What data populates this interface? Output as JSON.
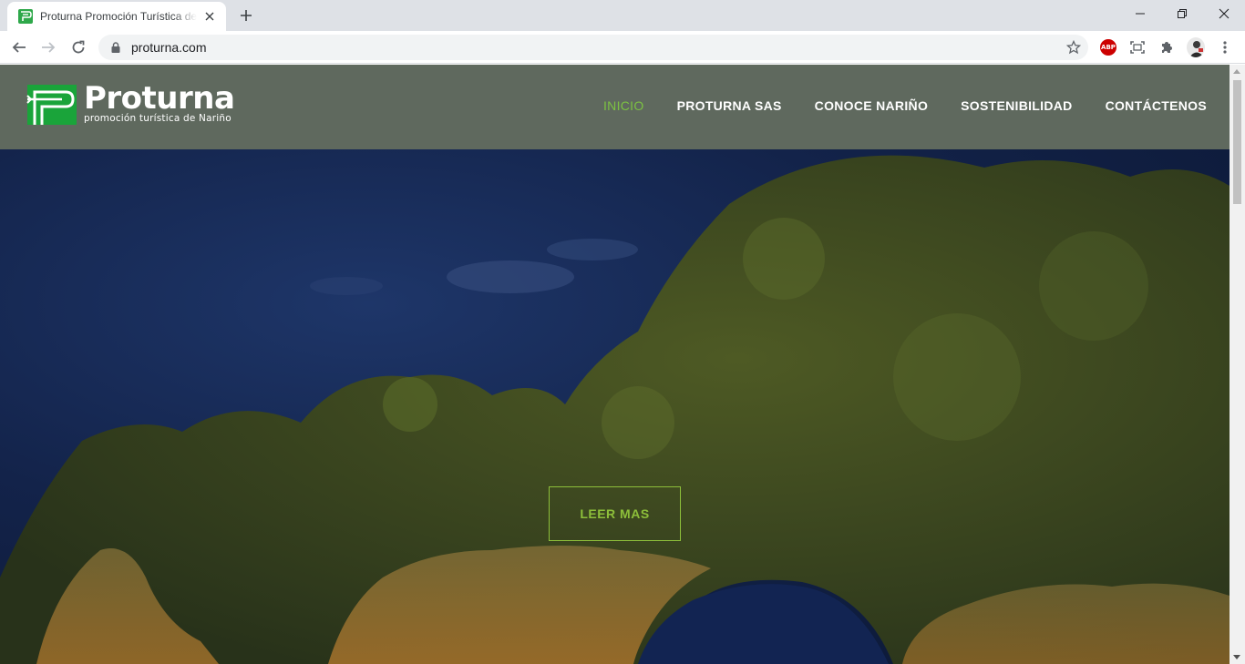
{
  "browser": {
    "tab_title": "Proturna Promoción Turística de Nariño",
    "url": "proturna.com",
    "extension_abp_label": "ABP",
    "accent_color": "#1a73e8"
  },
  "site": {
    "logo_name": "Proturna",
    "logo_tagline": "promoción turística de Nariño",
    "header_color": "#5f695e",
    "active_color": "#7cc242",
    "menu": [
      {
        "label": "INICIO",
        "active": true
      },
      {
        "label": "PROTURNA SAS",
        "active": false
      },
      {
        "label": "CONOCE NARIÑO",
        "active": false
      },
      {
        "label": "SOSTENIBILIDAD",
        "active": false
      },
      {
        "label": "CONTÁCTENOS",
        "active": false
      }
    ],
    "hero_button": "LEER MAS"
  }
}
